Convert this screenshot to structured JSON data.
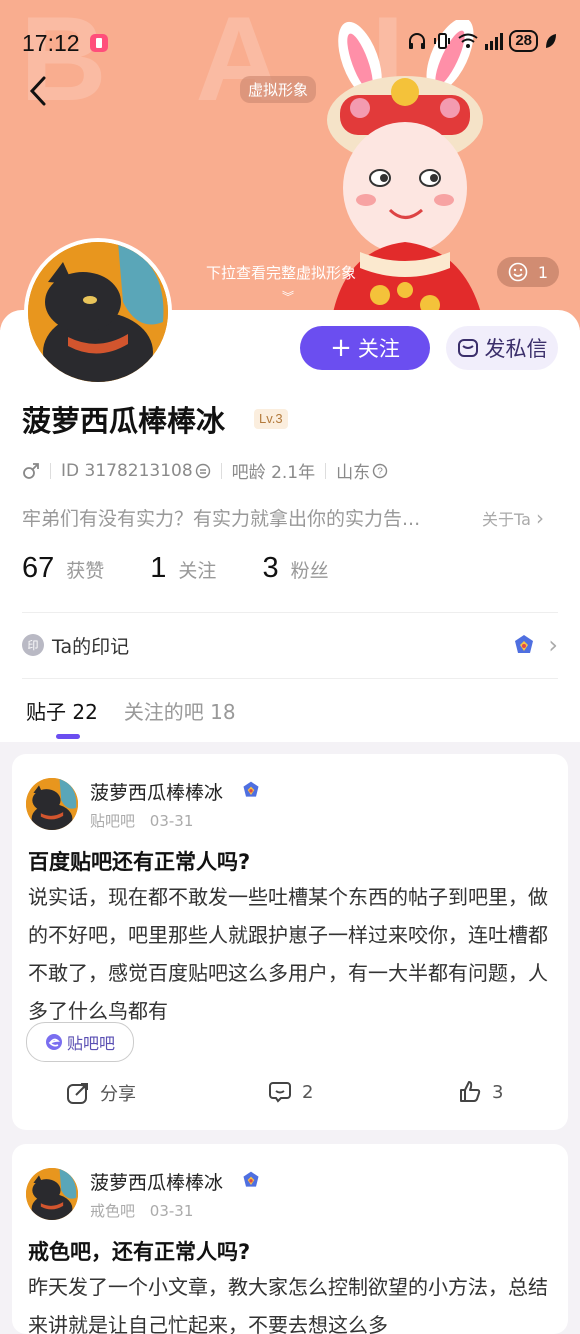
{
  "status_bar": {
    "time": "17:12",
    "battery": "28"
  },
  "hero": {
    "avatar_label": "虚拟形象",
    "pull_hint": "下拉查看完整虚拟形象",
    "smile_count": "1"
  },
  "profile": {
    "name": "菠萝西瓜棒棒冰",
    "level": "Lv.3",
    "gender_icon": "male-icon",
    "id_text": "ID 3178213108",
    "bar_age": "吧龄 2.1年",
    "location": "山东",
    "bio": "牢弟们有没有实力？有实力就拿出你的实力告...",
    "about": "关于Ta",
    "follow_label": "关注",
    "message_label": "发私信",
    "stats": [
      {
        "num": "67",
        "label": "获赞"
      },
      {
        "num": "1",
        "label": "关注"
      },
      {
        "num": "3",
        "label": "粉丝"
      }
    ],
    "seal_icon_char": "印",
    "seal_label": "Ta的印记"
  },
  "tabs": [
    {
      "label": "贴子 22"
    },
    {
      "label": "关注的吧 18"
    }
  ],
  "posts": [
    {
      "author": "菠萝西瓜棒棒冰",
      "forum": "贴吧吧",
      "date": "03-31",
      "title": "百度贴吧还有正常人吗?",
      "body": "说实话，现在都不敢发一些吐槽某个东西的帖子到吧里，做的不好吧，吧里那些人就跟护崽子一样过来咬你，连吐槽都不敢了，感觉百度贴吧这么多用户，有一大半都有问题，人多了什么鸟都有",
      "tag": "贴吧吧",
      "share_label": "分享",
      "comments": "2",
      "likes": "3"
    },
    {
      "author": "菠萝西瓜棒棒冰",
      "forum": "戒色吧",
      "date": "03-31",
      "title": "戒色吧，还有正常人吗?",
      "body": "昨天发了一个小文章，教大家怎么控制欲望的小方法，总结来讲就是让自己忙起来，不要去想这么多"
    }
  ],
  "colors": {
    "accent": "#6b4ef0",
    "hero_bg": "#f9ad8f"
  }
}
